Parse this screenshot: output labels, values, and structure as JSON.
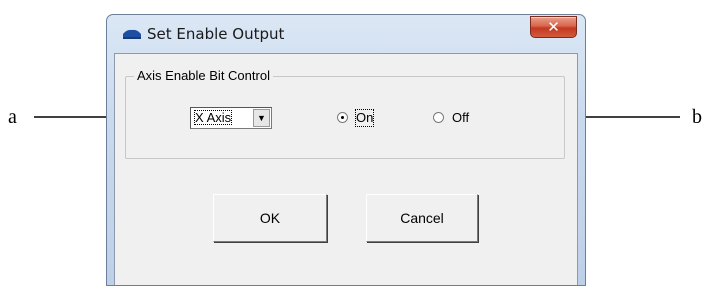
{
  "annotations": {
    "left_label": "a",
    "right_label": "b"
  },
  "window": {
    "title": "Set Enable Output",
    "close_symbol": "✕",
    "icon": "app-icon"
  },
  "group": {
    "title": "Axis Enable Bit Control",
    "axis_select": {
      "value": "X Axis",
      "arrow": "▼"
    },
    "radio_on": {
      "label": "On",
      "selected": true
    },
    "radio_off": {
      "label": "Off",
      "selected": false
    }
  },
  "buttons": {
    "ok": "OK",
    "cancel": "Cancel"
  }
}
